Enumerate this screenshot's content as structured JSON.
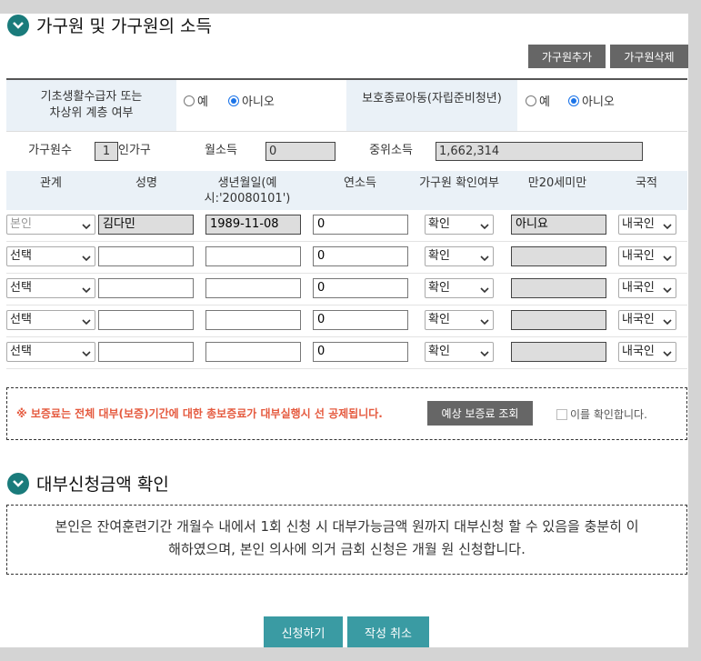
{
  "section1": {
    "title": "가구원 및 가구원의 소득"
  },
  "buttons": {
    "add_member": "가구원추가",
    "delete_member": "가구원삭제"
  },
  "eligibility": {
    "basic_label_line1": "기초생활수급자 또는",
    "basic_label_line2": "차상위 계층 여부",
    "basic_yes": "예",
    "basic_no": "아니오",
    "basic_selected": "아니오",
    "protected_label": "보호종료아동(자립준비청년)",
    "protected_yes": "예",
    "protected_no": "아니오",
    "protected_selected": "아니오"
  },
  "household": {
    "size_label": "가구원수",
    "size_value": "1",
    "size_unit": "인가구",
    "monthly_income_label": "월소득",
    "monthly_income_value": "0",
    "median_income_label": "중위소득",
    "median_income_value": "1,662,314"
  },
  "table": {
    "headers": {
      "relation": "관계",
      "name": "성명",
      "birth_line1": "생년월일(예",
      "birth_line2": "시:'20080101')",
      "income": "연소득",
      "confirm": "가구원 확인여부",
      "under20": "만20세미만",
      "nationality": "국적"
    },
    "rows": [
      {
        "relation": "본인",
        "name": "김다민",
        "birth": "1989-11-08",
        "income": "0",
        "confirm": "확인",
        "under20": "아니요",
        "nationality": "내국인"
      },
      {
        "relation": "선택",
        "name": "",
        "birth": "",
        "income": "0",
        "confirm": "확인",
        "under20": "",
        "nationality": "내국인"
      },
      {
        "relation": "선택",
        "name": "",
        "birth": "",
        "income": "0",
        "confirm": "확인",
        "under20": "",
        "nationality": "내국인"
      },
      {
        "relation": "선택",
        "name": "",
        "birth": "",
        "income": "0",
        "confirm": "확인",
        "under20": "",
        "nationality": "내국인"
      },
      {
        "relation": "선택",
        "name": "",
        "birth": "",
        "income": "0",
        "confirm": "확인",
        "under20": "",
        "nationality": "내국인"
      }
    ]
  },
  "notice": {
    "text": "※ 보증료는 전체 대부(보증)기간에 대한 총보증료가 대부실행시 선 공제됩니다.",
    "estimate_button": "예상 보증료 조회",
    "confirm_check": "이를 확인합니다."
  },
  "section2": {
    "title": "대부신청금액 확인",
    "statement_line1": "본인은 잔여훈련기간 개월수 내에서 1회 신청 시 대부가능금액 원까지 대부신청 할 수 있음을 충분히 이",
    "statement_line2": "해하였으며, 본인 의사에 의거 금회 신청은 개월 원 신청합니다."
  },
  "footer": {
    "apply": "신청하기",
    "cancel": "작성 취소"
  },
  "colors": {
    "accent": "#1a7b7b",
    "button_gray": "#666666",
    "button_teal": "#3a9ba3",
    "notice_red": "#e55a3f"
  }
}
